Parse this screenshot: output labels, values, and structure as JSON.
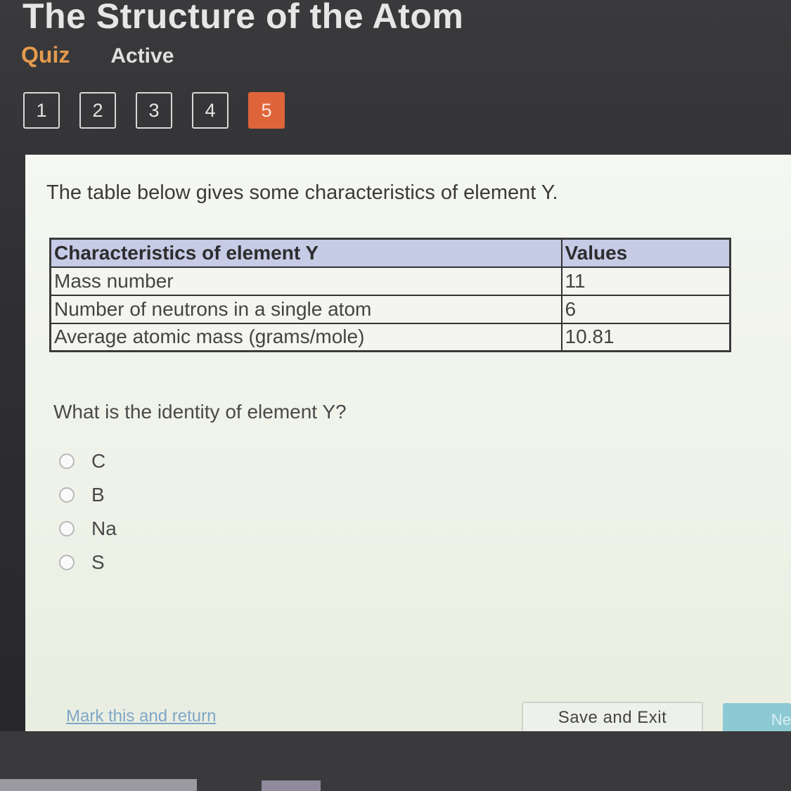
{
  "header": {
    "title": "The Structure of the Atom",
    "section": "Quiz",
    "status": "Active"
  },
  "question_nav": {
    "items": [
      "1",
      "2",
      "3",
      "4",
      "5"
    ],
    "current": "5"
  },
  "content": {
    "prompt": "The table below gives some characteristics of element Y.",
    "table": {
      "headers": [
        "Characteristics of element Y",
        "Values"
      ],
      "rows": [
        [
          "Mass number",
          "11"
        ],
        [
          "Number of neutrons in a single atom",
          "6"
        ],
        [
          "Average atomic mass (grams/mole)",
          "10.81"
        ]
      ]
    },
    "question": "What is the identity of element Y?",
    "options": [
      "C",
      "B",
      "Na",
      "S"
    ]
  },
  "footer": {
    "mark_link": "Mark this and return",
    "save_label": "Save and Exit",
    "next_label": "Ne"
  },
  "colors": {
    "accent": "#e59a4e",
    "current_question": "#e0643a",
    "next_button": "#8dc9d3",
    "table_header": "#c6cbe6"
  }
}
